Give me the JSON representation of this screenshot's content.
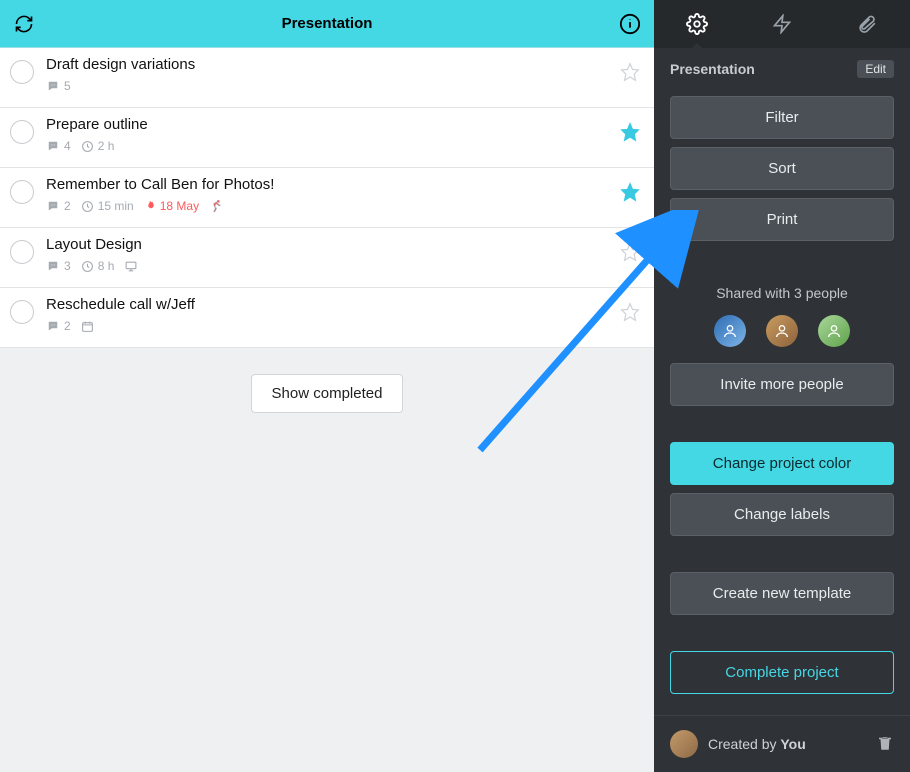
{
  "topbar": {
    "title": "Presentation",
    "refresh_icon": "refresh-icon",
    "info_icon": "info-icon"
  },
  "tasks": [
    {
      "title": "Draft design variations",
      "comments": "5",
      "time": null,
      "due": null,
      "starred": false,
      "running": false,
      "screen": false,
      "calendar": false
    },
    {
      "title": "Prepare outline",
      "comments": "4",
      "time": "2 h",
      "due": null,
      "starred": true,
      "running": false,
      "screen": false,
      "calendar": false
    },
    {
      "title": "Remember to Call Ben for Photos!",
      "comments": "2",
      "time": "15 min",
      "due": "18 May",
      "starred": true,
      "running": true,
      "screen": false,
      "calendar": false
    },
    {
      "title": "Layout Design",
      "comments": "3",
      "time": "8 h",
      "due": null,
      "starred": false,
      "running": false,
      "screen": true,
      "calendar": false
    },
    {
      "title": "Reschedule call w/Jeff",
      "comments": "2",
      "time": null,
      "due": null,
      "starred": false,
      "running": false,
      "screen": false,
      "calendar": true
    }
  ],
  "show_completed_label": "Show completed",
  "sidebar": {
    "tabs": {
      "settings_icon": "gear-icon",
      "actions_icon": "bolt-icon",
      "attachments_icon": "paperclip-icon"
    },
    "header": {
      "name": "Presentation",
      "edit_label": "Edit"
    },
    "filter_label": "Filter",
    "sort_label": "Sort",
    "print_label": "Print",
    "shared_label": "Shared with 3 people",
    "invite_label": "Invite more people",
    "change_color_label": "Change project color",
    "change_labels_label": "Change labels",
    "create_template_label": "Create new template",
    "complete_project_label": "Complete project",
    "footer": {
      "created_prefix": "Created by ",
      "creator": "You"
    },
    "accent_color": "#44d7e4"
  }
}
